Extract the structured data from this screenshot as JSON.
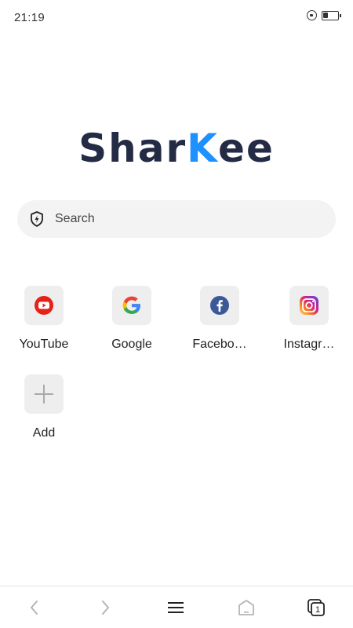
{
  "status_bar": {
    "time": "21:19",
    "battery_level": 0.35
  },
  "logo": {
    "part1": "Shar",
    "part2": "K",
    "part3": "ee"
  },
  "search": {
    "placeholder": "Search"
  },
  "shortcuts": [
    {
      "label": "YouTube",
      "icon": "youtube-icon"
    },
    {
      "label": "Google",
      "icon": "google-icon"
    },
    {
      "label": "Facebo…",
      "icon": "facebook-icon"
    },
    {
      "label": "Instagr…",
      "icon": "instagram-icon"
    },
    {
      "label": "Add",
      "icon": "add-icon"
    }
  ],
  "bottom_nav": {
    "tab_count": "1"
  },
  "colors": {
    "logo_dark": "#232b45",
    "logo_accent": "#1e90ff",
    "youtube_red": "#e62117",
    "facebook_blue": "#3b5998"
  }
}
